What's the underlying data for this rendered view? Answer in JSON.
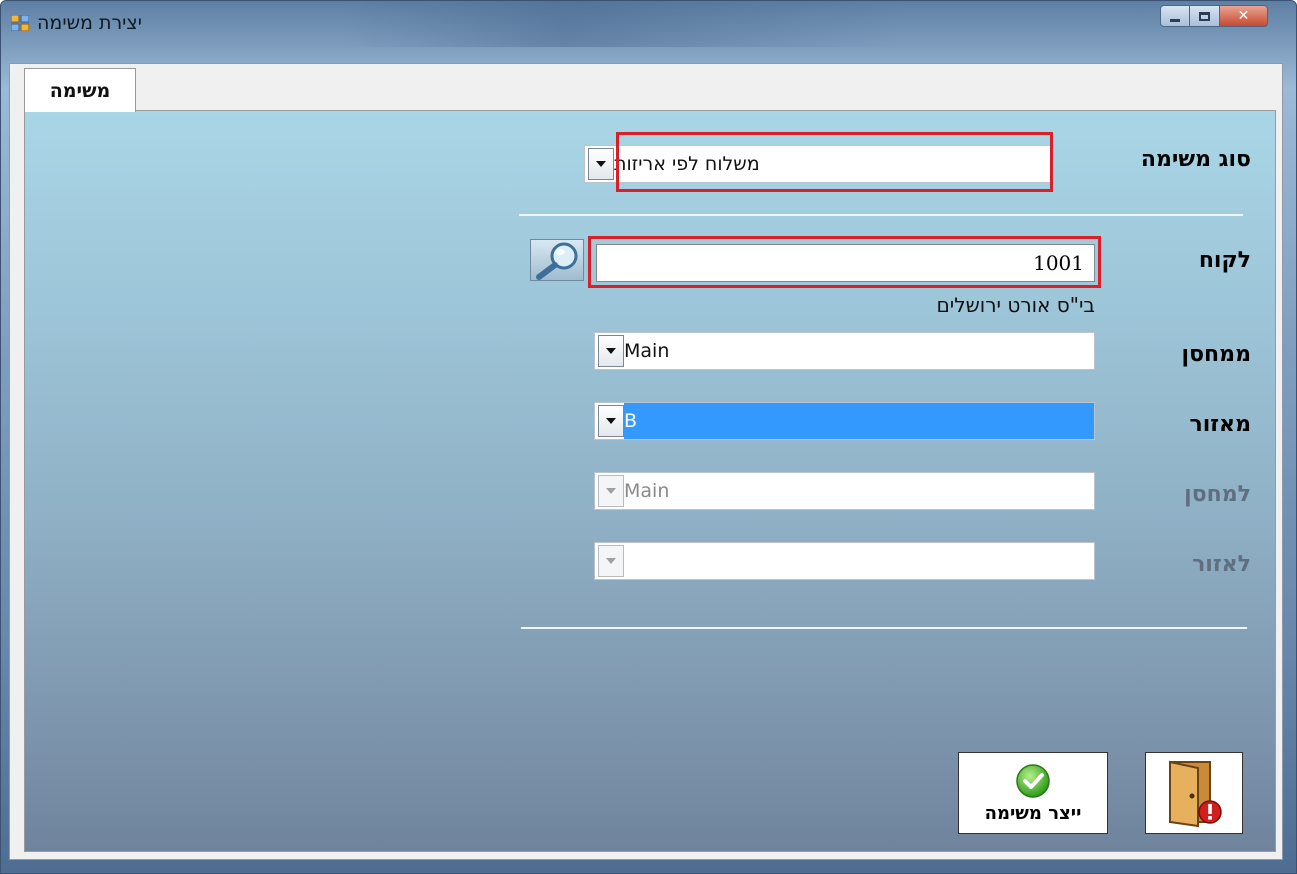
{
  "window": {
    "title": "יצירת משימה"
  },
  "tabs": [
    {
      "label": "משימה",
      "active": true
    }
  ],
  "form": {
    "task_type": {
      "label": "סוג משימה",
      "value": "משלוח לפי אריזות"
    },
    "customer": {
      "label": "לקוח",
      "value": "1001",
      "name": "בי\"ס אורט ירושלים"
    },
    "from_warehouse": {
      "label": "ממחסן",
      "value": "Main"
    },
    "from_zone": {
      "label": "מאזור",
      "value": "B"
    },
    "to_warehouse": {
      "label": "למחסן",
      "value": "Main",
      "disabled": true
    },
    "to_zone": {
      "label": "לאזור",
      "value": "",
      "disabled": true
    }
  },
  "buttons": {
    "create_task": {
      "label": "ייצר משימה",
      "icon": "green-check-icon"
    },
    "exit": {
      "icon": "exit-door-icon"
    }
  },
  "colors": {
    "highlight": "#d8202a",
    "selection": "#3399ff",
    "panel_top": "#a9d6e6",
    "panel_bottom": "#6f849c"
  }
}
